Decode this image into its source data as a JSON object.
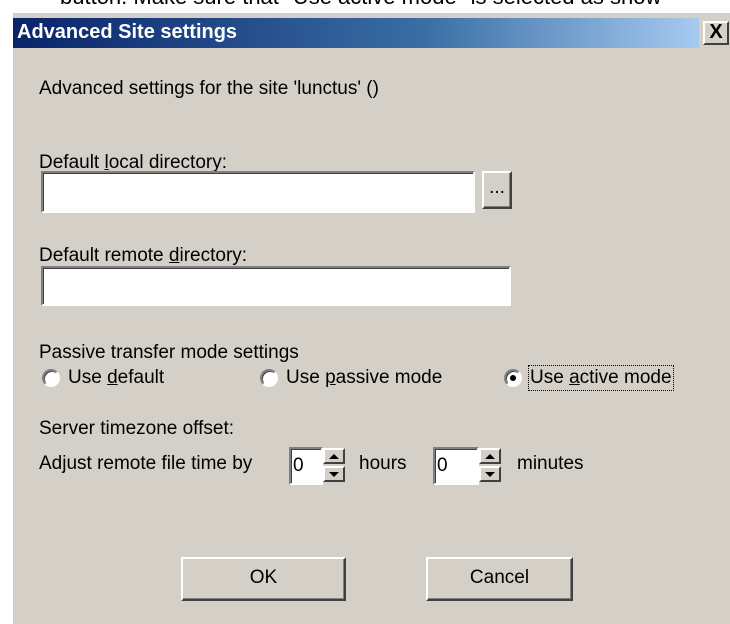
{
  "background_caption": "button. Make sure that \"Use active mode\" is selected as show",
  "dialog": {
    "title": "Advanced Site settings",
    "close_label": "X",
    "intro": "Advanced settings for the site 'lunctus' ()"
  },
  "local_dir": {
    "label_pre": "Default ",
    "label_key": "l",
    "label_post": "ocal directory:",
    "value": "",
    "browse_label": "..."
  },
  "remote_dir": {
    "label_pre": "Default remote ",
    "label_key": "d",
    "label_post": "irectory:",
    "value": ""
  },
  "passive": {
    "group_label": "Passive transfer mode settings",
    "options": [
      {
        "pre": "Use ",
        "key": "d",
        "post": "efault",
        "selected": false
      },
      {
        "pre": "Use ",
        "key": "p",
        "post": "assive mode",
        "selected": false
      },
      {
        "pre": "Use ",
        "key": "a",
        "post": "ctive mode",
        "selected": true
      }
    ]
  },
  "timezone": {
    "label": "Server timezone offset:",
    "adjust_label": "Adjust remote file time by",
    "hours_value": "0",
    "hours_label": "hours",
    "minutes_value": "0",
    "minutes_label": "minutes"
  },
  "buttons": {
    "ok": "OK",
    "cancel": "Cancel"
  }
}
